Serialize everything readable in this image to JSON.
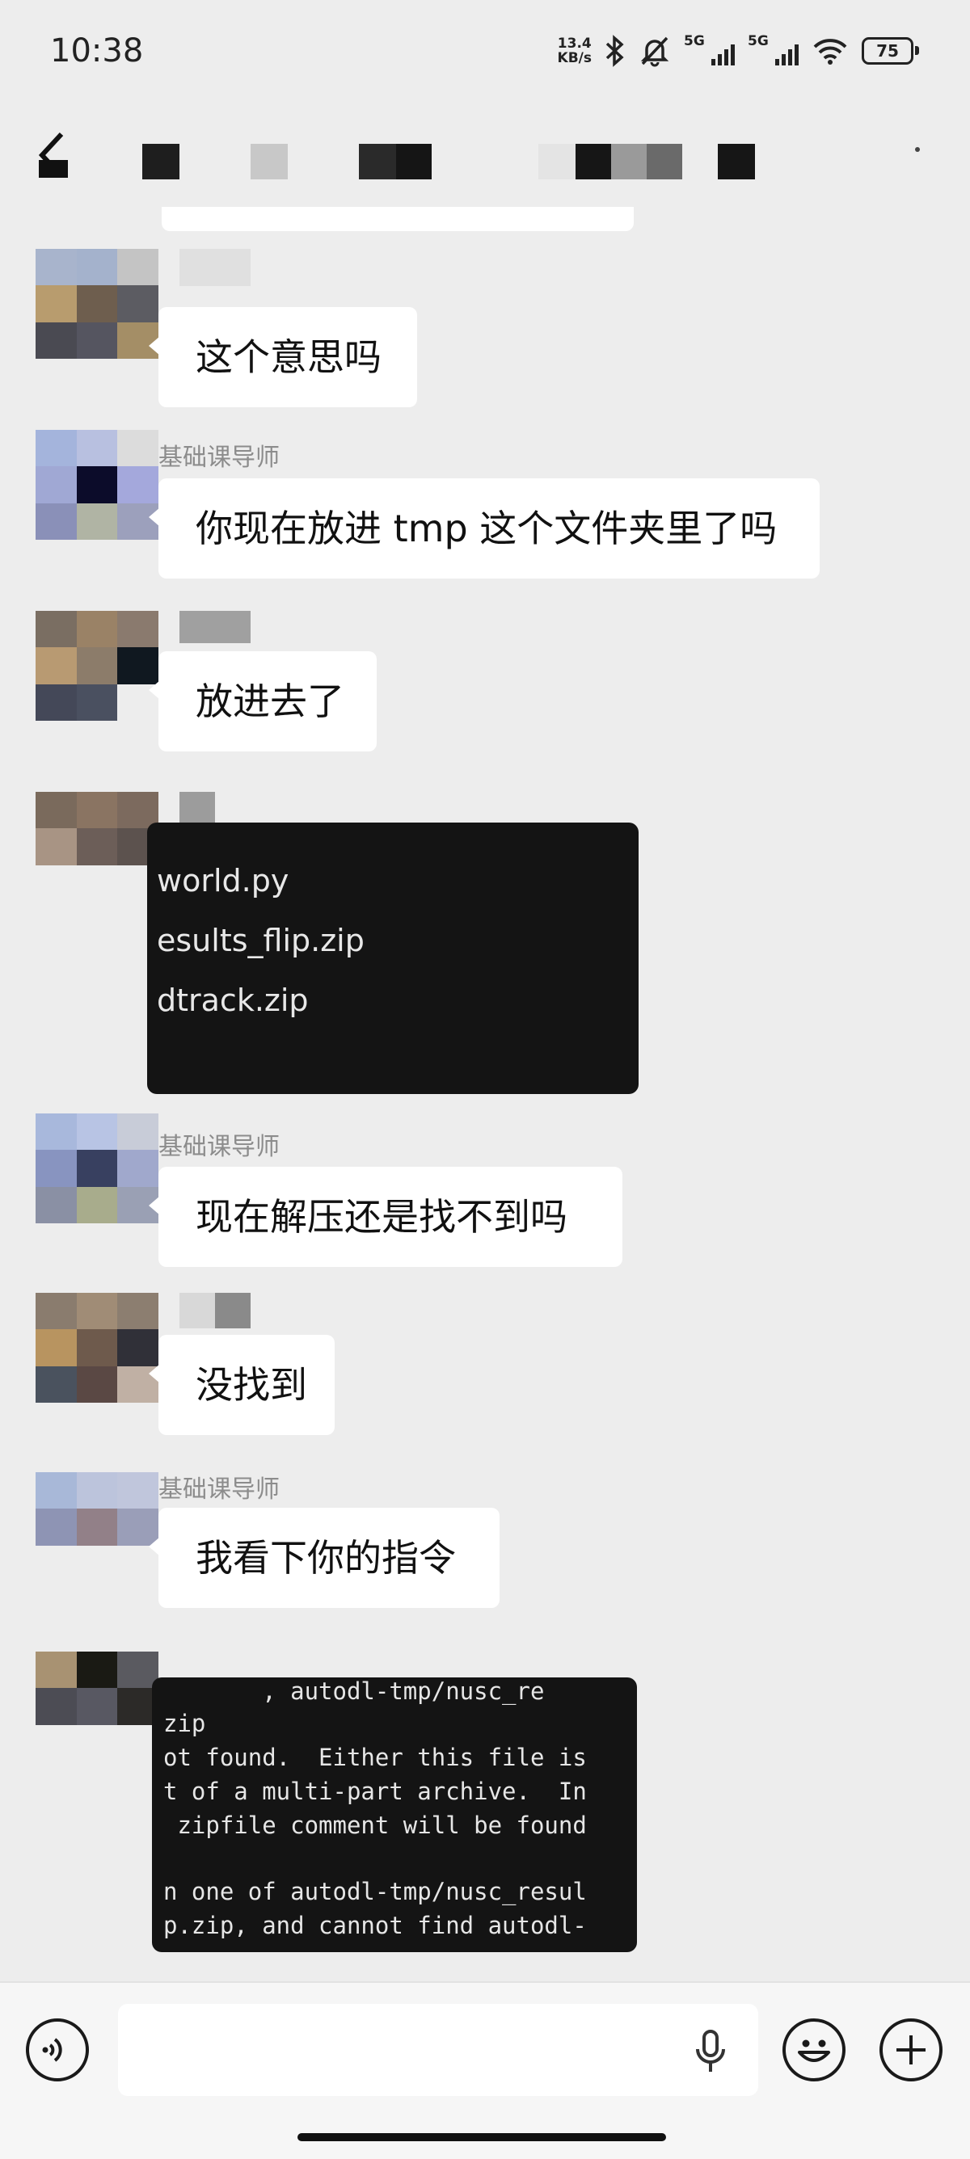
{
  "status_bar": {
    "time": "10:38",
    "net_speed_value": "13.4",
    "net_speed_unit": "KB/s",
    "signal1_label": "5G",
    "signal2_label": "5G",
    "battery": "75",
    "icons": [
      "bluetooth-icon",
      "mute-bell-icon",
      "signal-icon",
      "signal-icon",
      "wifi-icon",
      "battery-icon"
    ]
  },
  "nav": {
    "back_icon": "back-arrow-icon"
  },
  "messages": [
    {
      "sender": "",
      "text": "这个意思吗"
    },
    {
      "sender": "基础课导师",
      "text": "你现在放进 tmp 这个文件夹里了吗"
    },
    {
      "sender": "",
      "text": "放进去了"
    },
    {
      "sender": "",
      "image_lines": [
        "world.py",
        "esults_flip.zip",
        "dtrack.zip"
      ]
    },
    {
      "sender": "基础课导师",
      "text": "现在解压还是找不到吗"
    },
    {
      "sender": "",
      "text": "没找到"
    },
    {
      "sender": "基础课导师",
      "text": "我看下你的指令"
    },
    {
      "sender": "",
      "terminal_lines": [
        "       , autodl-tmp/nusc_re",
        "zip",
        "ot found.  Either this file is",
        "t of a multi-part archive.  In",
        " zipfile comment will be found",
        "",
        "n one of autodl-tmp/nusc_resul",
        "p.zip, and cannot find autodl-"
      ]
    }
  ],
  "input_bar": {
    "voice_icon": "voice-icon",
    "input_value": "",
    "mic_icon": "microphone-icon",
    "emoji_icon": "emoji-icon",
    "plus_icon": "plus-icon"
  },
  "colors": {
    "background": "#ededed",
    "bubble": "#ffffff",
    "image_bg": "#141414"
  }
}
